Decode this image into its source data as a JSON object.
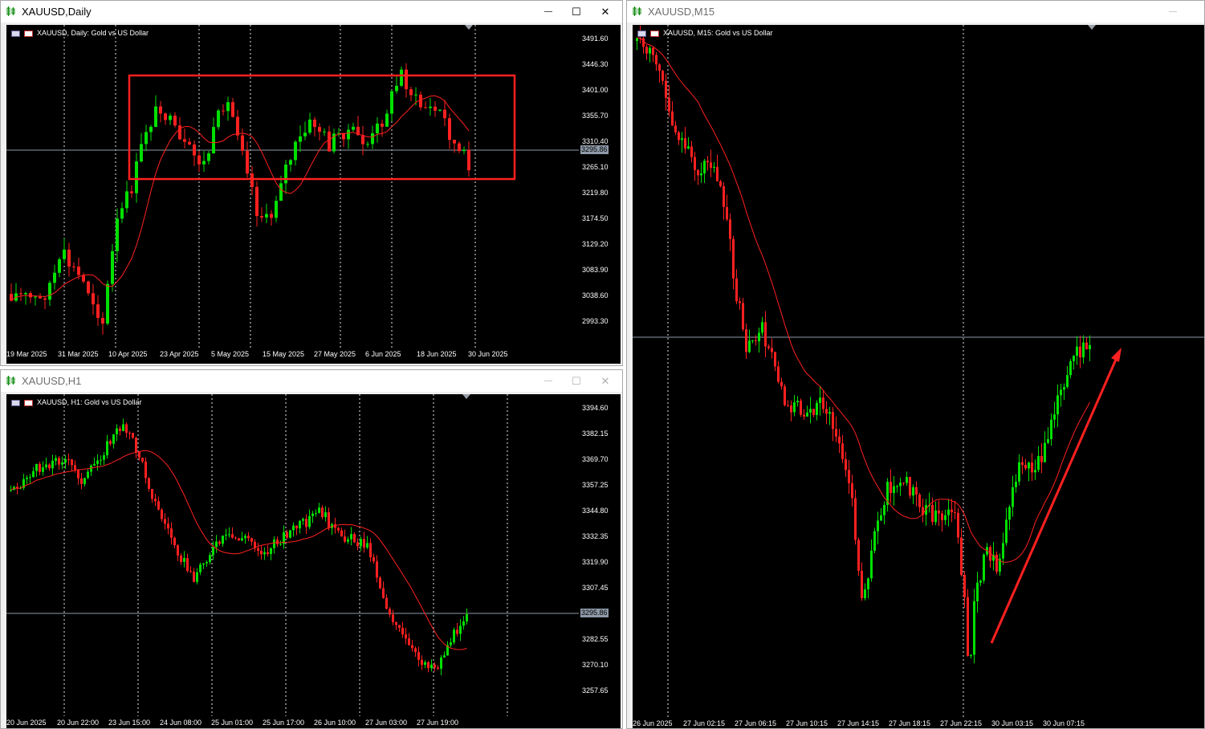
{
  "windows": {
    "daily": {
      "title": "XAUUSD,Daily",
      "header": "XAUUSD, Daily:  Gold vs US Dollar",
      "y_labels": [
        "3491.60",
        "3446.30",
        "3401.00",
        "3355.70",
        "3310.40",
        "3265.10",
        "3219.80",
        "3174.50",
        "3129.20",
        "3083.90",
        "3038.60",
        "2993.30"
      ],
      "current_price": "3295.86",
      "x_labels": [
        "19 Mar 2025",
        "31 Mar 2025",
        "10 Apr 2025",
        "23 Apr 2025",
        "5 May 2025",
        "15 May 2025",
        "27 May 2025",
        "6 Jun 2025",
        "18 Jun 2025",
        "30 Jun 2025"
      ]
    },
    "h1": {
      "title": "XAUUSD,H1",
      "header": "XAUUSD, H1:  Gold vs US Dollar",
      "y_labels": [
        "3394.60",
        "3382.15",
        "3369.70",
        "3357.25",
        "3344.80",
        "3332.35",
        "3319.90",
        "3307.45",
        "3282.55",
        "3270.10",
        "3257.65"
      ],
      "current_price": "3295.86",
      "x_labels": [
        "20 Jun 2025",
        "20 Jun 22:00",
        "23 Jun 15:00",
        "24 Jun 08:00",
        "25 Jun 01:00",
        "25 Jun 17:00",
        "26 Jun 10:00",
        "27 Jun 03:00",
        "27 Jun 19:00"
      ]
    },
    "m15": {
      "title": "XAUUSD,M15",
      "header": "XAUUSD, M15:  Gold vs US Dollar",
      "x_labels": [
        "26 Jun 2025",
        "27 Jun 02:15",
        "27 Jun 06:15",
        "27 Jun 10:15",
        "27 Jun 14:15",
        "27 Jun 18:15",
        "27 Jun 22:15",
        "30 Jun 03:15",
        "30 Jun 07:15"
      ]
    }
  },
  "window_buttons": {
    "minimize": "—",
    "maximize": "☐",
    "close": "✕"
  },
  "colors": {
    "bull": "#00e000",
    "bear": "#ff2020",
    "ma": "#ff2020",
    "annotation": "#ff2020",
    "background": "#000000",
    "grid": "#ffffff"
  },
  "icons": {
    "title": "chart-candles-icon",
    "symbol_flag": "us-flag-icon",
    "symbol_gold": "gold-icon"
  }
}
